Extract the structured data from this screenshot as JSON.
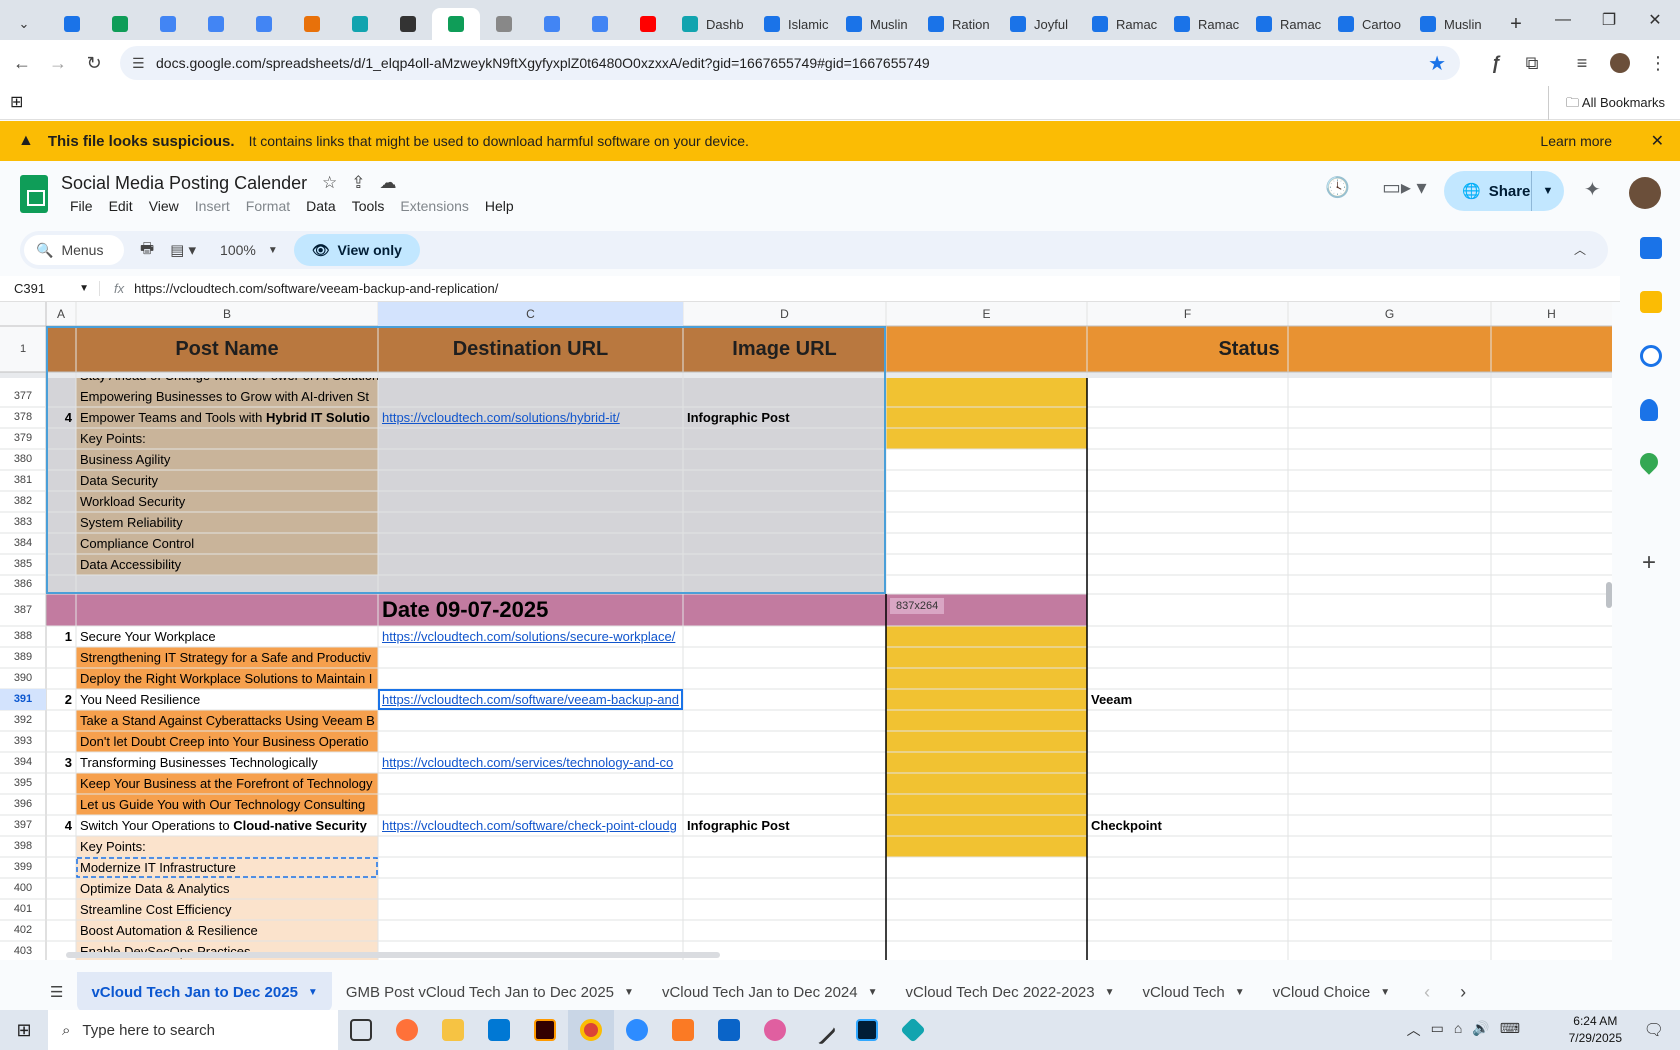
{
  "browser": {
    "tabs": [
      {
        "label": "",
        "color": "#1a73e8"
      },
      {
        "label": "",
        "color": "#0f9d58"
      },
      {
        "label": "",
        "color": "#4285f4"
      },
      {
        "label": "",
        "color": "#4285f4"
      },
      {
        "label": "",
        "color": "#4285f4"
      },
      {
        "label": "",
        "color": "#e8710a"
      },
      {
        "label": "",
        "color": "#12a4af"
      },
      {
        "label": "",
        "color": "#333333"
      },
      {
        "label": "",
        "color": "#0f9d58",
        "active": true
      },
      {
        "label": "",
        "color": "#888888"
      },
      {
        "label": "",
        "color": "#4285f4"
      },
      {
        "label": "",
        "color": "#4285f4"
      },
      {
        "label": "",
        "color": "#ff0000"
      },
      {
        "label": "Dashb",
        "color": "#12a4af"
      },
      {
        "label": "Islamic",
        "color": "#1a73e8"
      },
      {
        "label": "Muslin",
        "color": "#1a73e8"
      },
      {
        "label": "Ration",
        "color": "#1a73e8"
      },
      {
        "label": "Joyful",
        "color": "#1a73e8"
      },
      {
        "label": "Ramac",
        "color": "#1a73e8"
      },
      {
        "label": "Ramac",
        "color": "#1a73e8"
      },
      {
        "label": "Ramac",
        "color": "#1a73e8"
      },
      {
        "label": "Cartoo",
        "color": "#1a73e8"
      },
      {
        "label": "Muslin",
        "color": "#1a73e8"
      }
    ],
    "new_tab": "+",
    "url": "docs.google.com/spreadsheets/d/1_elqp4oll-aMzweykN9ftXgyfyxplZ0t6480O0xzxxA/edit?gid=1667655749#gid=1667655749",
    "all_bookmarks": "All Bookmarks"
  },
  "warning": {
    "title": "This file looks suspicious.",
    "message": "It contains links that might be used to download harmful software on your device.",
    "learn_more": "Learn more"
  },
  "doc": {
    "title": "Social Media Posting Calender",
    "menus": [
      {
        "label": "File",
        "disabled": false
      },
      {
        "label": "Edit",
        "disabled": false
      },
      {
        "label": "View",
        "disabled": false
      },
      {
        "label": "Insert",
        "disabled": true
      },
      {
        "label": "Format",
        "disabled": true
      },
      {
        "label": "Data",
        "disabled": false
      },
      {
        "label": "Tools",
        "disabled": false
      },
      {
        "label": "Extensions",
        "disabled": true
      },
      {
        "label": "Help",
        "disabled": false
      }
    ],
    "share_label": "Share"
  },
  "toolbar": {
    "menus_label": "Menus",
    "zoom": "100%",
    "view_only": "View only"
  },
  "formula": {
    "cell_ref": "C391",
    "fx": "fx",
    "value": "https://vcloudtech.com/software/veeam-backup-and-replication/"
  },
  "grid": {
    "columns": [
      "A",
      "B",
      "C",
      "D",
      "E",
      "F",
      "G",
      "H"
    ],
    "header_row": {
      "row_num": "1",
      "post_name": "Post Name",
      "destination_url": "Destination URL",
      "image_url": "Image URL",
      "status": "Status"
    },
    "size_tooltip": "837x264",
    "date_banner": "Date 09-07-2025",
    "partial_row_text": "Stay Ahead of Change with the Power of AI Solutions",
    "rows": [
      {
        "num": "377",
        "a": "",
        "b": "Empowering Businesses to Grow with AI-driven St",
        "c": "",
        "d": "",
        "f": ""
      },
      {
        "num": "378",
        "a": "4",
        "b": "Empower Teams and Tools with Hybrid IT Solutio",
        "c": "https://vcloudtech.com/solutions/hybrid-it/",
        "d": "Infographic Post",
        "f": ""
      },
      {
        "num": "379",
        "a": "",
        "b": "Key Points:",
        "c": "",
        "d": "",
        "f": ""
      },
      {
        "num": "380",
        "a": "",
        "b": "Business Agility",
        "c": "",
        "d": "",
        "f": ""
      },
      {
        "num": "381",
        "a": "",
        "b": "Data Security",
        "c": "",
        "d": "",
        "f": ""
      },
      {
        "num": "382",
        "a": "",
        "b": "Workload Security",
        "c": "",
        "d": "",
        "f": ""
      },
      {
        "num": "383",
        "a": "",
        "b": "System Reliability",
        "c": "",
        "d": "",
        "f": ""
      },
      {
        "num": "384",
        "a": "",
        "b": "Compliance Control",
        "c": "",
        "d": "",
        "f": ""
      },
      {
        "num": "385",
        "a": "",
        "b": "Data Accessibility",
        "c": "",
        "d": "",
        "f": ""
      },
      {
        "num": "386",
        "a": "",
        "b": "",
        "c": "",
        "d": "",
        "f": ""
      },
      {
        "num": "387",
        "a": "",
        "b": "",
        "c": "",
        "d": "",
        "f": ""
      },
      {
        "num": "388",
        "a": "1",
        "b": "Secure Your Workplace",
        "c": "https://vcloudtech.com/solutions/secure-workplace/",
        "d": "",
        "f": ""
      },
      {
        "num": "389",
        "a": "",
        "b": "Strengthening IT Strategy for a Safe and Productiv",
        "c": "",
        "d": "",
        "f": ""
      },
      {
        "num": "390",
        "a": "",
        "b": "Deploy the Right Workplace Solutions to Maintain I",
        "c": "",
        "d": "",
        "f": ""
      },
      {
        "num": "391",
        "a": "2",
        "b": "You Need Resilience",
        "c": "https://vcloudtech.com/software/veeam-backup-and",
        "d": "",
        "f": "Veeam"
      },
      {
        "num": "392",
        "a": "",
        "b": "Take a Stand Against Cyberattacks Using Veeam B",
        "c": "",
        "d": "",
        "f": ""
      },
      {
        "num": "393",
        "a": "",
        "b": "Don't let Doubt Creep into Your Business Operatio",
        "c": "",
        "d": "",
        "f": ""
      },
      {
        "num": "394",
        "a": "3",
        "b": "Transforming Businesses Technologically",
        "c": "https://vcloudtech.com/services/technology-and-co",
        "d": "",
        "f": ""
      },
      {
        "num": "395",
        "a": "",
        "b": "Keep Your Business at the Forefront of Technology",
        "c": "",
        "d": "",
        "f": ""
      },
      {
        "num": "396",
        "a": "",
        "b": "Let us Guide You with Our Technology Consulting",
        "c": "",
        "d": "",
        "f": ""
      },
      {
        "num": "397",
        "a": "4",
        "b": "Switch Your Operations to Cloud-native Security",
        "c": "https://vcloudtech.com/software/check-point-cloudg",
        "d": "Infographic Post",
        "f": "Checkpoint"
      },
      {
        "num": "398",
        "a": "",
        "b": "Key Points:",
        "c": "",
        "d": "",
        "f": ""
      },
      {
        "num": "399",
        "a": "",
        "b": "Modernize IT Infrastructure",
        "c": "",
        "d": "",
        "f": ""
      },
      {
        "num": "400",
        "a": "",
        "b": "Optimize Data & Analytics",
        "c": "",
        "d": "",
        "f": ""
      },
      {
        "num": "401",
        "a": "",
        "b": "Streamline Cost Efficiency",
        "c": "",
        "d": "",
        "f": ""
      },
      {
        "num": "402",
        "a": "",
        "b": "Boost Automation & Resilience",
        "c": "",
        "d": "",
        "f": ""
      },
      {
        "num": "403",
        "a": "",
        "b": "Enable DevSecOps Practices",
        "c": "",
        "d": "",
        "f": ""
      }
    ]
  },
  "sheet_tabs": [
    {
      "label": "vCloud Tech Jan to Dec 2025",
      "active": true
    },
    {
      "label": "GMB Post vCloud Tech Jan to Dec 2025",
      "active": false
    },
    {
      "label": "vCloud Tech Jan to Dec 2024",
      "active": false
    },
    {
      "label": "vCloud Tech Dec 2022-2023",
      "active": false
    },
    {
      "label": "vCloud Tech",
      "active": false
    },
    {
      "label": "vCloud Choice",
      "active": false
    }
  ],
  "taskbar": {
    "search_placeholder": "Type here to search",
    "time": "6:24 AM",
    "date": "7/29/2025"
  },
  "colors": {
    "header_orange": "#b9783f",
    "status_orange": "#e89232",
    "tan": "#c9b49a",
    "peach": "#fbe3cc",
    "bright_orange": "#f6a04d",
    "yellow": "#f1c232",
    "date_mauve": "#c27ba0",
    "selection_gray": "#d4d4d8",
    "link": "#1155cc"
  }
}
